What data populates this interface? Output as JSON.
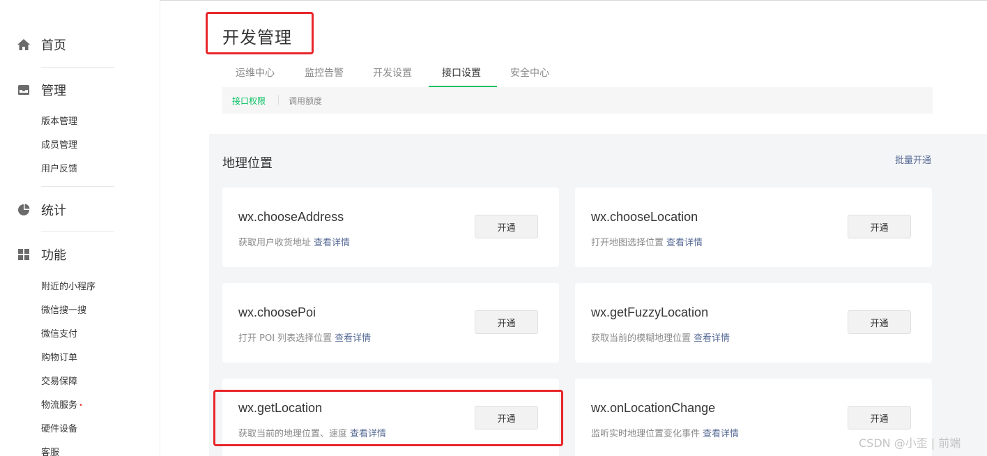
{
  "sidebar": {
    "home": {
      "label": "首页",
      "icon": "home-icon"
    },
    "manage": {
      "label": "管理",
      "icon": "inbox-icon",
      "items": [
        "版本管理",
        "成员管理",
        "用户反馈"
      ]
    },
    "stats": {
      "label": "统计",
      "icon": "pie-chart-icon"
    },
    "features": {
      "label": "功能",
      "icon": "grid-icon",
      "items": [
        "附近的小程序",
        "微信搜一搜",
        "微信支付",
        "购物订单",
        "交易保障",
        "物流服务",
        "硬件设备",
        "客服"
      ]
    },
    "new_badge": "•"
  },
  "page": {
    "title": "开发管理",
    "tabs": [
      "运维中心",
      "监控告警",
      "开发设置",
      "接口设置",
      "安全中心"
    ],
    "active_tab": "接口设置",
    "subtabs": [
      "接口权限",
      "调用额度"
    ],
    "active_subtab": "接口权限"
  },
  "section": {
    "title": "地理位置",
    "batch_label": "批量开通",
    "detail_link": "查看详情",
    "open_label": "开通",
    "cards": [
      {
        "api": "wx.chooseAddress",
        "desc": "获取用户收货地址"
      },
      {
        "api": "wx.chooseLocation",
        "desc": "打开地图选择位置"
      },
      {
        "api": "wx.choosePoi",
        "desc": "打开 POI 列表选择位置"
      },
      {
        "api": "wx.getFuzzyLocation",
        "desc": "获取当前的模糊地理位置"
      },
      {
        "api": "wx.getLocation",
        "desc": "获取当前的地理位置、速度"
      },
      {
        "api": "wx.onLocationChange",
        "desc": "监听实时地理位置变化事件"
      }
    ]
  },
  "watermark": "CSDN @小歪 | 前端",
  "colors": {
    "accent": "#07c160",
    "link": "#576b95",
    "highlight": "#e8262a"
  }
}
